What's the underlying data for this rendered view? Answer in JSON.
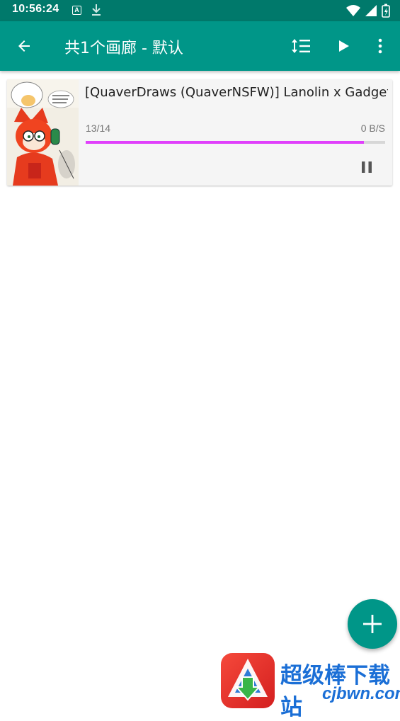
{
  "status_bar": {
    "time": "10:56:24",
    "notification_letter": "A",
    "icons": [
      "a-notification-icon",
      "download-icon",
      "wifi-icon",
      "signal-icon",
      "battery-icon"
    ]
  },
  "app_bar": {
    "title": "共1个画廊 - 默认",
    "background": "#009688",
    "actions": [
      "back-arrow-icon",
      "sort-icon",
      "play-icon",
      "more-vert-icon"
    ]
  },
  "downloads": [
    {
      "title": "[QuaverDraws (QuaverNSFW)] Lanolin x Gadget",
      "pages": "13/14",
      "speed": "0 B/S",
      "progress": 0.93,
      "progress_color": "#e040fb"
    }
  ],
  "fab": {
    "icon": "add-icon"
  },
  "watermark": {
    "name": "超级棒下载站",
    "url": "cjbwn.com"
  }
}
